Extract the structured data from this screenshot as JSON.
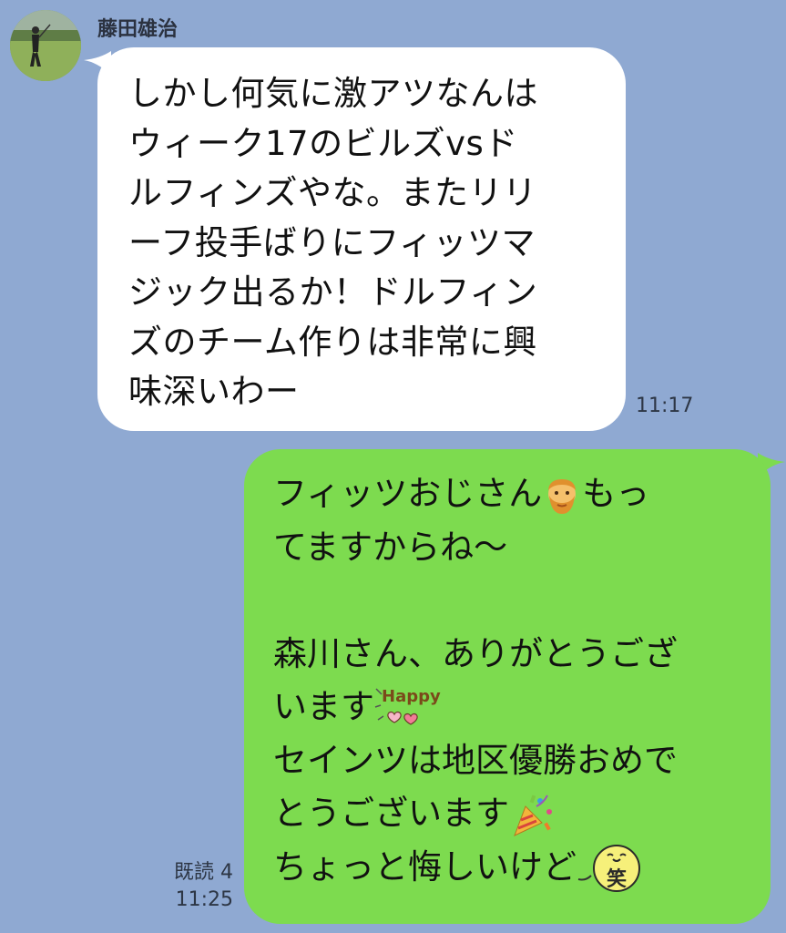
{
  "contact": {
    "name": "藤田雄治"
  },
  "incoming": {
    "lines": [
      "しかし何気に激アツなんは",
      "ウィーク17のビルズvsド",
      "ルフィンズやな。またリリ",
      "ーフ投手ばりにフィッツマ",
      "ジック出るか！ドルフィン",
      "ズのチーム作りは非常に興",
      "味深いわー"
    ],
    "time": "11:17"
  },
  "outgoing": {
    "line1_pre": "フィッツおじさん",
    "line1_post": "もっ",
    "line2": "てますからね〜",
    "line3": "",
    "line4": "森川さん、ありがとうござ",
    "line5": "います",
    "line6": "セインツは地区優勝おめで",
    "line7": "とうございます",
    "line8": "ちょっと悔しいけど",
    "read_label": "既読 4",
    "time": "11:25"
  },
  "stickers": {
    "happy_text": "Happy",
    "laugh_text": "笑"
  },
  "colors": {
    "background": "#8fa9d2",
    "incoming_bubble": "#ffffff",
    "outgoing_bubble": "#7ddb4f"
  },
  "icons": [
    "avatar-photo",
    "bearded-man-emoji",
    "happy-hearts-sticker",
    "party-popper-emoji",
    "laugh-face-sticker"
  ]
}
